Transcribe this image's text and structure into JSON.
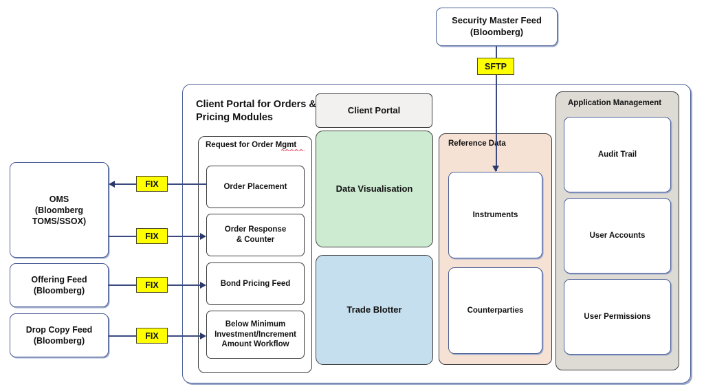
{
  "diagram": {
    "title": "Client Portal for Orders & Pricing Modules",
    "colors": {
      "accent_blue_border": "#4A5E96",
      "connector_blue": "#3B4A7E",
      "chip_yellow": "#FFFF00",
      "data_visualisation_green": "#CDEBD1",
      "trade_blotter_blue": "#C6DFEF",
      "reference_data_peach": "#F6E2D5",
      "application_management_grey": "#DEDBD5",
      "client_portal_grey": "#F2F1EF"
    }
  },
  "external_systems": {
    "oms": "OMS\n(Bloomberg\nTOMS/SSOX)",
    "offering_feed": "Offering Feed\n(Bloomberg)",
    "drop_copy_feed": "Drop Copy Feed\n(Bloomberg)",
    "security_master_feed": "Security Master Feed\n(Bloomberg)"
  },
  "protocol_chips": {
    "fix_1": "FIX",
    "fix_2": "FIX",
    "fix_3": "FIX",
    "fix_4": "FIX",
    "sftp": "SFTP"
  },
  "panels": {
    "request_for_order_mgmt": {
      "title": "Request for Order Mgmt",
      "items": [
        {
          "label": "Order Placement"
        },
        {
          "label": "Order Response\n& Counter"
        },
        {
          "label": "Bond Pricing Feed"
        },
        {
          "label": "Below Minimum\nInvestment/Increment\nAmount Workflow"
        }
      ]
    },
    "reference_data": {
      "title": "Reference Data",
      "items": [
        {
          "label": "Instruments"
        },
        {
          "label": "Counterparties"
        }
      ]
    },
    "application_management": {
      "title": "Application Management",
      "items": [
        {
          "label": "Audit Trail"
        },
        {
          "label": "User Accounts"
        },
        {
          "label": "User Permissions"
        }
      ]
    }
  },
  "feature_tiles": {
    "client_portal": "Client Portal",
    "data_visualisation": "Data Visualisation",
    "trade_blotter": "Trade Blotter"
  }
}
